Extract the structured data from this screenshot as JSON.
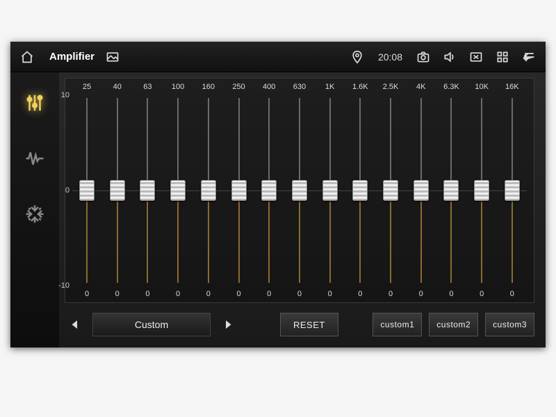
{
  "header": {
    "title": "Amplifier",
    "clock": "20:08"
  },
  "sidebar": {
    "items": [
      "eq",
      "wave",
      "fader"
    ],
    "active": 0
  },
  "eq": {
    "bands": [
      "25",
      "40",
      "63",
      "100",
      "160",
      "250",
      "400",
      "630",
      "1K",
      "1.6K",
      "2.5K",
      "4K",
      "6.3K",
      "10K",
      "16K"
    ],
    "values": [
      0,
      0,
      0,
      0,
      0,
      0,
      0,
      0,
      0,
      0,
      0,
      0,
      0,
      0,
      0
    ],
    "ticks": [
      "10",
      "0",
      "-10"
    ]
  },
  "preset": {
    "current": "Custom"
  },
  "buttons": {
    "reset": "RESET",
    "custom1": "custom1",
    "custom2": "custom2",
    "custom3": "custom3"
  }
}
